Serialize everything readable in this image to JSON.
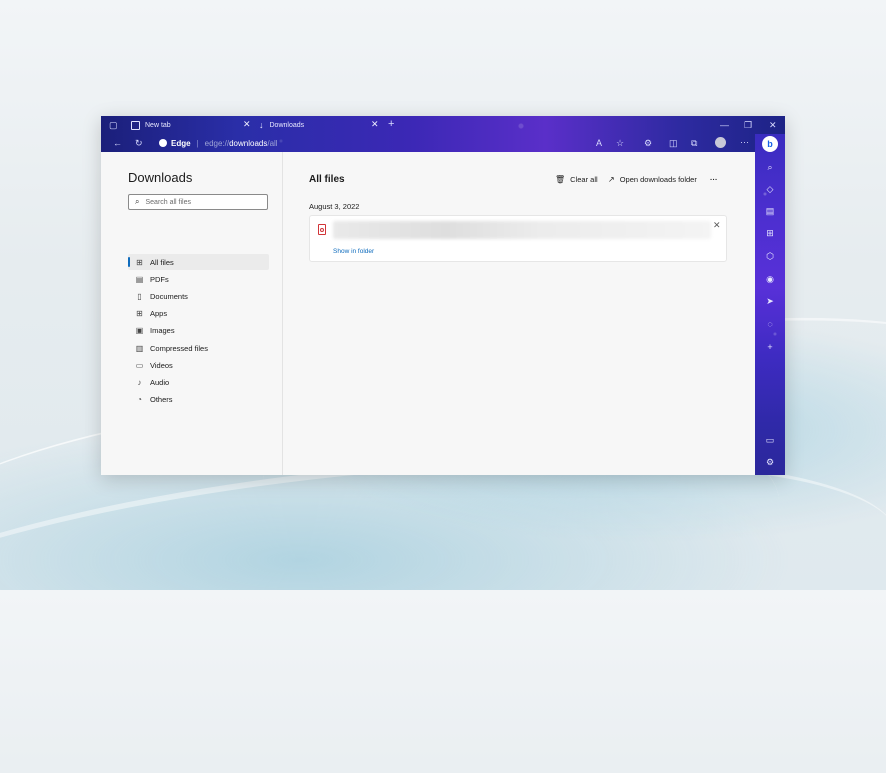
{
  "browser": {
    "tabs": [
      {
        "label": "New tab"
      },
      {
        "label": "Downloads"
      }
    ],
    "new_tab_symbol": "+",
    "address_brand": "Edge",
    "url_host": "edge://",
    "url_path": "downloads",
    "url_suffix": "/all",
    "window_controls": [
      "—",
      "❐",
      "✕"
    ],
    "toolbar_icons": [
      "read-aloud-icon",
      "favorites-icon",
      "extensions-icon",
      "split-screen-icon",
      "collections-icon",
      "workspace-icon",
      "profile-icon",
      "more-icon"
    ]
  },
  "downloads": {
    "title": "Downloads",
    "search_placeholder": "Search all files",
    "nav": [
      {
        "label": "All files",
        "icon": "grid-icon"
      },
      {
        "label": "PDFs",
        "icon": "pdf-icon"
      },
      {
        "label": "Documents",
        "icon": "document-icon"
      },
      {
        "label": "Apps",
        "icon": "apps-icon"
      },
      {
        "label": "Images",
        "icon": "image-icon"
      },
      {
        "label": "Compressed files",
        "icon": "archive-icon"
      },
      {
        "label": "Videos",
        "icon": "video-icon"
      },
      {
        "label": "Audio",
        "icon": "audio-icon"
      },
      {
        "label": "Others",
        "icon": "others-icon"
      }
    ],
    "main_title": "All files",
    "clear_all": "Clear all",
    "open_folder": "Open downloads folder",
    "more": "···",
    "date_group": "August 3, 2022",
    "item": {
      "show_in_folder": "Show in folder",
      "close": "✕"
    }
  },
  "sidebar": {
    "bing_label": "b",
    "icons": [
      "search-icon",
      "shopping-icon",
      "tools-icon",
      "office-icon",
      "outlook-icon",
      "games-icon",
      "telegram-icon",
      "drop-icon",
      "add-icon",
      "sidebar-toggle-icon",
      "settings-icon"
    ]
  },
  "colors": {
    "accent": "#0f6cbd",
    "pdf_red": "#d13438",
    "theme_purple": "#4d2fd0"
  }
}
